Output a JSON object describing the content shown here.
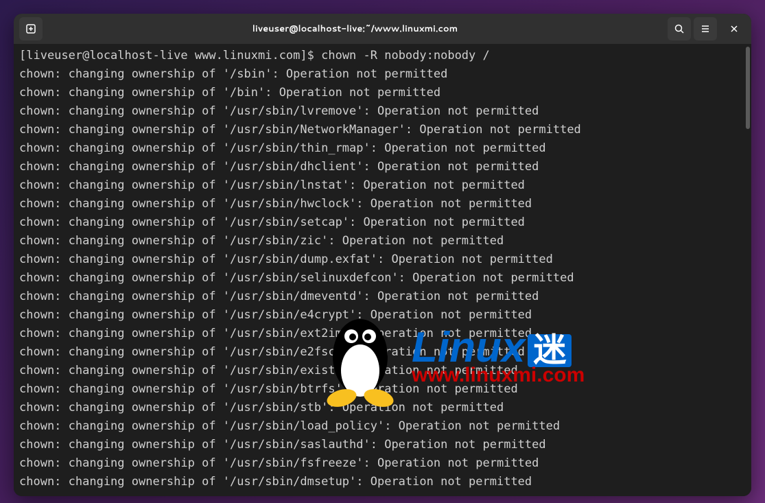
{
  "titlebar": {
    "title": "liveuser@localhost-live:~/www.linuxmi.com"
  },
  "terminal": {
    "prompt": "[liveuser@localhost-live www.linuxmi.com]$ ",
    "command": "chown -R nobody:nobody /",
    "output_lines": [
      "chown: changing ownership of '/sbin': Operation not permitted",
      "chown: changing ownership of '/bin': Operation not permitted",
      "chown: changing ownership of '/usr/sbin/lvremove': Operation not permitted",
      "chown: changing ownership of '/usr/sbin/NetworkManager': Operation not permitted",
      "chown: changing ownership of '/usr/sbin/thin_rmap': Operation not permitted",
      "chown: changing ownership of '/usr/sbin/dhclient': Operation not permitted",
      "chown: changing ownership of '/usr/sbin/lnstat': Operation not permitted",
      "chown: changing ownership of '/usr/sbin/hwclock': Operation not permitted",
      "chown: changing ownership of '/usr/sbin/setcap': Operation not permitted",
      "chown: changing ownership of '/usr/sbin/zic': Operation not permitted",
      "chown: changing ownership of '/usr/sbin/dump.exfat': Operation not permitted",
      "chown: changing ownership of '/usr/sbin/selinuxdefcon': Operation not permitted",
      "chown: changing ownership of '/usr/sbin/dmeventd': Operation not permitted",
      "chown: changing ownership of '/usr/sbin/e4crypt': Operation not permitted",
      "chown: changing ownership of '/usr/sbin/ext2img': Operation not permitted",
      "chown: changing ownership of '/usr/sbin/e2fsck': Operation not permitted",
      "chown: changing ownership of '/usr/sbin/exist': Operation not permitted",
      "chown: changing ownership of '/usr/sbin/btrfs': Operation not permitted",
      "chown: changing ownership of '/usr/sbin/stb': Operation not permitted",
      "chown: changing ownership of '/usr/sbin/load_policy': Operation not permitted",
      "chown: changing ownership of '/usr/sbin/saslauthd': Operation not permitted",
      "chown: changing ownership of '/usr/sbin/fsfreeze': Operation not permitted",
      "chown: changing ownership of '/usr/sbin/dmsetup': Operation not permitted"
    ]
  },
  "watermark": {
    "brand_linux": "Linux",
    "brand_mi": "迷",
    "url": "www.linuxmi.com"
  }
}
